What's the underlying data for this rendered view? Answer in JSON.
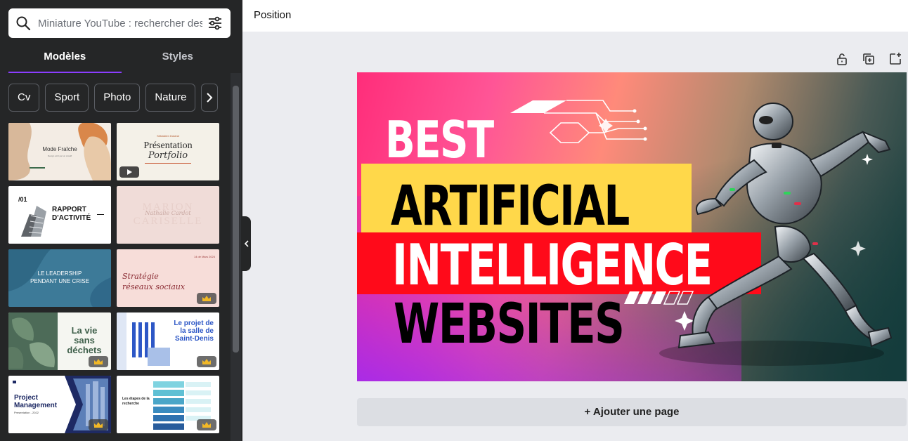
{
  "search": {
    "placeholder": "Miniature YouTube : rechercher des modèles"
  },
  "tabs": [
    {
      "label": "Modèles",
      "active": true
    },
    {
      "label": "Styles",
      "active": false
    }
  ],
  "chips": [
    "Cv",
    "Sport",
    "Photo",
    "Nature"
  ],
  "templates": {
    "t1": {
      "title": "Mode Fraîche",
      "sub": "Design écrit par un créatif"
    },
    "t2": {
      "top": "Sébastien Dutand",
      "title": "Présentation",
      "script": "Portfolio"
    },
    "t3": {
      "num": "/01",
      "title1": "RAPPORT",
      "title2": "D'ACTIVITÉ"
    },
    "t4": {
      "title1": "MARION",
      "title2": "CARISELLE",
      "script": "Nathalie Cardot"
    },
    "t5": {
      "title1": "LE LEADERSHIP",
      "title2": "PENDANT UNE CRISE"
    },
    "t6": {
      "date": "14 de Mars 2024",
      "title1": "Stratégie",
      "title2": "réseaux sociaux"
    },
    "t7": {
      "title1": "La vie",
      "title2": "sans",
      "title3": "déchets"
    },
    "t8": {
      "title1": "Le projet de",
      "title2": "la salle de",
      "title3": "Saint-Denis"
    },
    "t9": {
      "title1": "Project",
      "title2": "Management",
      "sub": "Presentation - 2022"
    },
    "t10": {
      "title1": "Les étapes de la",
      "title2": "recherche"
    }
  },
  "topbar": {
    "position_label": "Position"
  },
  "canvas": {
    "line1": "BEST",
    "line2": "ARTIFICIAL",
    "line3": "INTELLIGENCE",
    "line4": "WEBSITES",
    "colors": {
      "pink": "#ff2d7a",
      "yellow": "#ffd84a",
      "red": "#ff0a1a",
      "purple": "#a028f0"
    }
  },
  "add_page": {
    "label": "+ Ajouter une page"
  },
  "icons": [
    "search-icon",
    "filter-icon",
    "chevron-right-icon",
    "chevron-left-icon",
    "lock-icon",
    "duplicate-icon",
    "add-page-icon",
    "crown-icon",
    "play-icon"
  ]
}
